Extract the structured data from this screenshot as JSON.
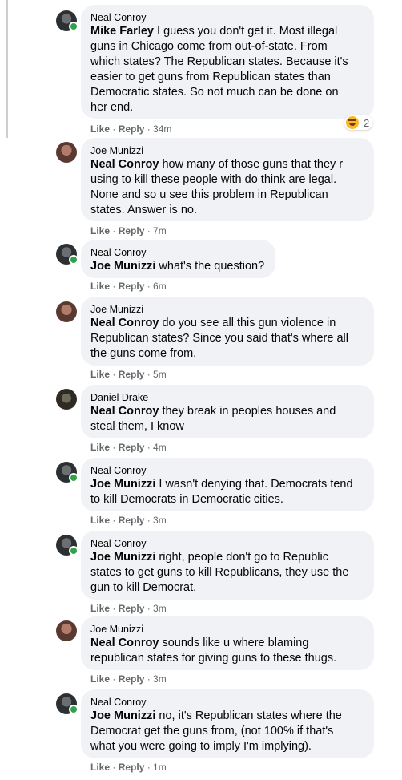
{
  "comments": [
    {
      "author": "Neal Conroy",
      "mention": "Mike Farley",
      "lines": [
        "I guess you don't get it. Most illegal",
        "guns in Chicago come from out-of-state. From",
        "which states? The Republican states. Because it's",
        "easier to get guns from Republican states than",
        "Democratic states. So not much can be done on",
        "her end."
      ],
      "like": "Like",
      "reply": "Reply",
      "time": "34m",
      "reaction_count": "2"
    },
    {
      "author": "Joe Munizzi",
      "mention": "Neal Conroy",
      "lines": [
        "how many of those guns that they r",
        "using to kill these people with do think are legal.",
        "None and so u see this problem in Republican",
        "states. Answer is no."
      ],
      "like": "Like",
      "reply": "Reply",
      "time": "7m"
    },
    {
      "author": "Neal Conroy",
      "mention": "Joe Munizzi",
      "lines": [
        "what's the question?"
      ],
      "like": "Like",
      "reply": "Reply",
      "time": "6m"
    },
    {
      "author": "Joe Munizzi",
      "mention": "Neal Conroy",
      "lines": [
        "do you see all this gun violence in",
        "Republican states? Since you said that's where all",
        "the guns come from."
      ],
      "like": "Like",
      "reply": "Reply",
      "time": "5m"
    },
    {
      "author": "Daniel Drake",
      "mention": "Neal Conroy",
      "lines": [
        "they break in peoples houses and",
        "steal them, I know"
      ],
      "like": "Like",
      "reply": "Reply",
      "time": "4m"
    },
    {
      "author": "Neal Conroy",
      "mention": "Joe Munizzi",
      "lines": [
        "I wasn't denying that. Democrats tend",
        "to kill Democrats in Democratic cities."
      ],
      "like": "Like",
      "reply": "Reply",
      "time": "3m"
    },
    {
      "author": "Neal Conroy",
      "mention": "Joe Munizzi",
      "lines": [
        "right, people don't go to Republic",
        "states to get guns to kill Republicans, they use the",
        "gun to kill Democrat."
      ],
      "like": "Like",
      "reply": "Reply",
      "time": "3m"
    },
    {
      "author": "Joe Munizzi",
      "mention": "Neal Conroy",
      "lines": [
        "sounds like u where blaming",
        "republican states for giving guns to these thugs."
      ],
      "like": "Like",
      "reply": "Reply",
      "time": "3m"
    },
    {
      "author": "Neal Conroy",
      "mention": "Joe Munizzi",
      "lines": [
        "no, it's Republican states where the",
        "Democrat get the guns from, (not 100% if that's",
        "what you were going to imply I'm implying)."
      ],
      "like": "Like",
      "reply": "Reply",
      "time": "1m"
    }
  ],
  "reaction_icon": "laughing-emoji-icon",
  "colors": {
    "bubble": "#f0f2f5",
    "meta": "#65676b",
    "online": "#31a24c"
  }
}
